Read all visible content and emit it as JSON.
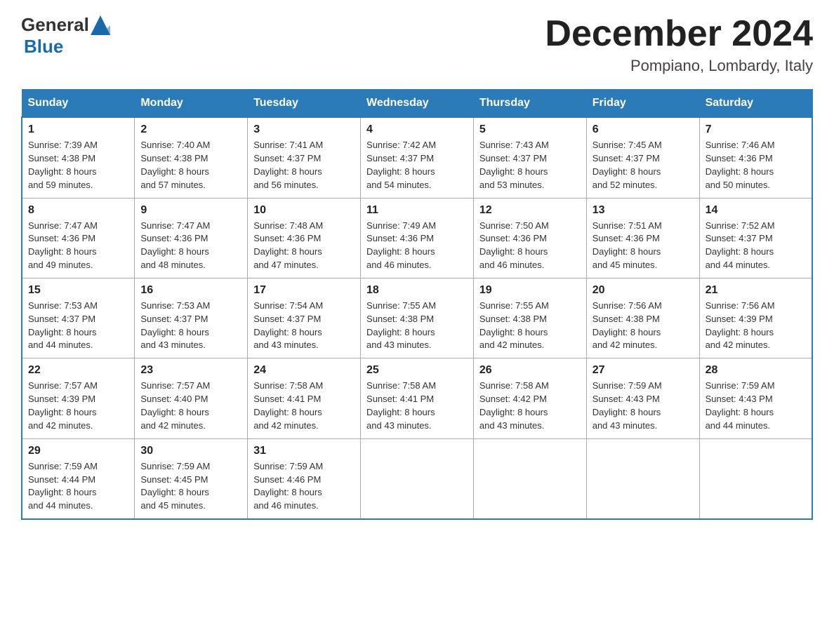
{
  "logo": {
    "general": "General",
    "blue": "Blue",
    "subtitle": "Blue"
  },
  "title": "December 2024",
  "location": "Pompiano, Lombardy, Italy",
  "days_header": [
    "Sunday",
    "Monday",
    "Tuesday",
    "Wednesday",
    "Thursday",
    "Friday",
    "Saturday"
  ],
  "weeks": [
    [
      {
        "day": "1",
        "sunrise": "7:39 AM",
        "sunset": "4:38 PM",
        "daylight": "8 hours and 59 minutes."
      },
      {
        "day": "2",
        "sunrise": "7:40 AM",
        "sunset": "4:38 PM",
        "daylight": "8 hours and 57 minutes."
      },
      {
        "day": "3",
        "sunrise": "7:41 AM",
        "sunset": "4:37 PM",
        "daylight": "8 hours and 56 minutes."
      },
      {
        "day": "4",
        "sunrise": "7:42 AM",
        "sunset": "4:37 PM",
        "daylight": "8 hours and 54 minutes."
      },
      {
        "day": "5",
        "sunrise": "7:43 AM",
        "sunset": "4:37 PM",
        "daylight": "8 hours and 53 minutes."
      },
      {
        "day": "6",
        "sunrise": "7:45 AM",
        "sunset": "4:37 PM",
        "daylight": "8 hours and 52 minutes."
      },
      {
        "day": "7",
        "sunrise": "7:46 AM",
        "sunset": "4:36 PM",
        "daylight": "8 hours and 50 minutes."
      }
    ],
    [
      {
        "day": "8",
        "sunrise": "7:47 AM",
        "sunset": "4:36 PM",
        "daylight": "8 hours and 49 minutes."
      },
      {
        "day": "9",
        "sunrise": "7:47 AM",
        "sunset": "4:36 PM",
        "daylight": "8 hours and 48 minutes."
      },
      {
        "day": "10",
        "sunrise": "7:48 AM",
        "sunset": "4:36 PM",
        "daylight": "8 hours and 47 minutes."
      },
      {
        "day": "11",
        "sunrise": "7:49 AM",
        "sunset": "4:36 PM",
        "daylight": "8 hours and 46 minutes."
      },
      {
        "day": "12",
        "sunrise": "7:50 AM",
        "sunset": "4:36 PM",
        "daylight": "8 hours and 46 minutes."
      },
      {
        "day": "13",
        "sunrise": "7:51 AM",
        "sunset": "4:36 PM",
        "daylight": "8 hours and 45 minutes."
      },
      {
        "day": "14",
        "sunrise": "7:52 AM",
        "sunset": "4:37 PM",
        "daylight": "8 hours and 44 minutes."
      }
    ],
    [
      {
        "day": "15",
        "sunrise": "7:53 AM",
        "sunset": "4:37 PM",
        "daylight": "8 hours and 44 minutes."
      },
      {
        "day": "16",
        "sunrise": "7:53 AM",
        "sunset": "4:37 PM",
        "daylight": "8 hours and 43 minutes."
      },
      {
        "day": "17",
        "sunrise": "7:54 AM",
        "sunset": "4:37 PM",
        "daylight": "8 hours and 43 minutes."
      },
      {
        "day": "18",
        "sunrise": "7:55 AM",
        "sunset": "4:38 PM",
        "daylight": "8 hours and 43 minutes."
      },
      {
        "day": "19",
        "sunrise": "7:55 AM",
        "sunset": "4:38 PM",
        "daylight": "8 hours and 42 minutes."
      },
      {
        "day": "20",
        "sunrise": "7:56 AM",
        "sunset": "4:38 PM",
        "daylight": "8 hours and 42 minutes."
      },
      {
        "day": "21",
        "sunrise": "7:56 AM",
        "sunset": "4:39 PM",
        "daylight": "8 hours and 42 minutes."
      }
    ],
    [
      {
        "day": "22",
        "sunrise": "7:57 AM",
        "sunset": "4:39 PM",
        "daylight": "8 hours and 42 minutes."
      },
      {
        "day": "23",
        "sunrise": "7:57 AM",
        "sunset": "4:40 PM",
        "daylight": "8 hours and 42 minutes."
      },
      {
        "day": "24",
        "sunrise": "7:58 AM",
        "sunset": "4:41 PM",
        "daylight": "8 hours and 42 minutes."
      },
      {
        "day": "25",
        "sunrise": "7:58 AM",
        "sunset": "4:41 PM",
        "daylight": "8 hours and 43 minutes."
      },
      {
        "day": "26",
        "sunrise": "7:58 AM",
        "sunset": "4:42 PM",
        "daylight": "8 hours and 43 minutes."
      },
      {
        "day": "27",
        "sunrise": "7:59 AM",
        "sunset": "4:43 PM",
        "daylight": "8 hours and 43 minutes."
      },
      {
        "day": "28",
        "sunrise": "7:59 AM",
        "sunset": "4:43 PM",
        "daylight": "8 hours and 44 minutes."
      }
    ],
    [
      {
        "day": "29",
        "sunrise": "7:59 AM",
        "sunset": "4:44 PM",
        "daylight": "8 hours and 44 minutes."
      },
      {
        "day": "30",
        "sunrise": "7:59 AM",
        "sunset": "4:45 PM",
        "daylight": "8 hours and 45 minutes."
      },
      {
        "day": "31",
        "sunrise": "7:59 AM",
        "sunset": "4:46 PM",
        "daylight": "8 hours and 46 minutes."
      },
      null,
      null,
      null,
      null
    ]
  ],
  "labels": {
    "sunrise": "Sunrise:",
    "sunset": "Sunset:",
    "daylight": "Daylight:"
  }
}
